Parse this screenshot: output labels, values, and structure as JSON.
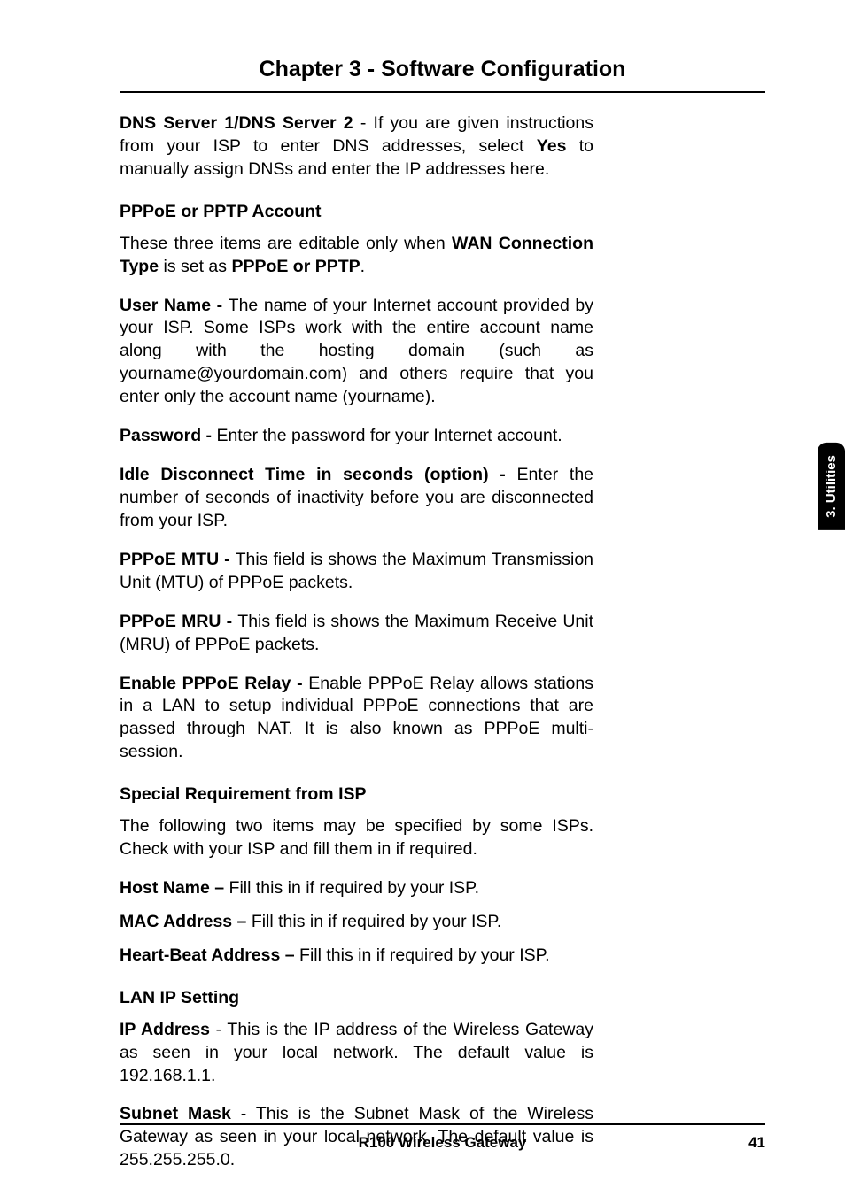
{
  "chapter_title": "Chapter 3 - Software Configuration",
  "dns": {
    "label": "DNS Server 1/DNS Server 2",
    "sep": " - ",
    "text1": "If you are given instructions from your ISP to enter DNS addresses, select ",
    "yes": "Yes",
    "text2": " to manually assign DNSs and enter the IP addresses here."
  },
  "pppoe_section": {
    "heading": "PPPoE or PPTP Account",
    "intro1": "These three items are editable only when ",
    "intro_bold1": "WAN Connection Type",
    "intro2": " is set as ",
    "intro_bold2": "PPPoE or PPTP",
    "intro3": ".",
    "username_label": "User Name - ",
    "username_text": "The name of your Internet account provided by your ISP. Some ISPs work with the entire account name along with the hosting domain (such as yourname@yourdomain.com) and others require that you enter only the account name (yourname).",
    "password_label": "Password - ",
    "password_text": "Enter the password for your Internet account.",
    "idle_label": "Idle Disconnect Time in seconds (option) - ",
    "idle_text": "Enter the number of seconds of inactivity before you are disconnected from your ISP.",
    "mtu_label": "PPPoE MTU - ",
    "mtu_text": "This field is shows the Maximum Transmission Unit (MTU) of PPPoE packets.",
    "mru_label": "PPPoE MRU - ",
    "mru_text": "This field is shows the Maximum Receive Unit (MRU) of PPPoE packets.",
    "relay_label": "Enable PPPoE Relay - ",
    "relay_text": "Enable PPPoE Relay allows stations in a LAN to setup individual PPPoE connections that are passed through NAT. It is also known as PPPoE multi-session."
  },
  "special_section": {
    "heading": "Special Requirement from ISP",
    "intro": "The following two items may be specified by some ISPs. Check with your ISP and fill them in if required.",
    "host_label": "Host Name – ",
    "host_text": "Fill this in if required by your ISP.",
    "mac_label": "MAC Address – ",
    "mac_text": "Fill this in if required by your ISP.",
    "heart_label": "Heart-Beat Address – ",
    "heart_text": "Fill this in if required by your ISP."
  },
  "lan_section": {
    "heading": "LAN IP Setting",
    "ip_label": "IP Address",
    "ip_sep": " - ",
    "ip_text": "This is the IP address of the Wireless Gateway as seen in your local network. The default value is 192.168.1.1.",
    "subnet_label": "Subnet Mask",
    "subnet_sep": " - ",
    "subnet_text": "This is the Subnet Mask of the Wireless Gateway as seen in your local network. The default value is 255.255.255.0."
  },
  "side_tab": "3. Utilities",
  "footer": {
    "center": "R100 Wireless Gateway",
    "page": "41"
  }
}
